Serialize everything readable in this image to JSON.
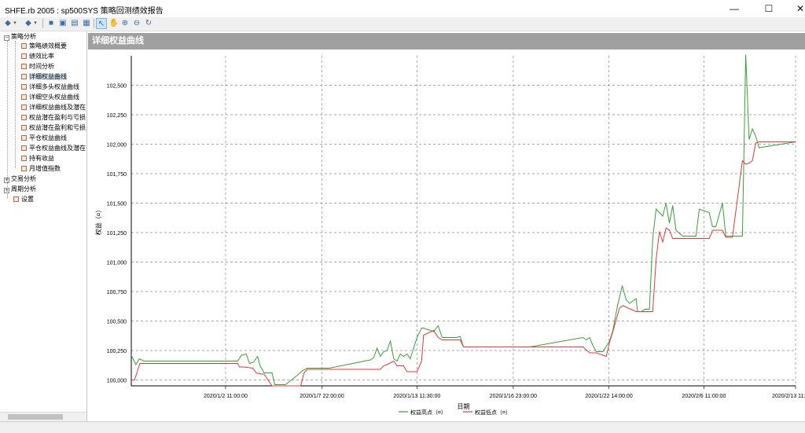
{
  "window": {
    "title": "SHFE.rb 2005 : sp500SYS 策略回测绩效报告",
    "minimize_glyph": "—",
    "maximize_glyph": "☐",
    "close_glyph": "✕"
  },
  "toolbar": {
    "icons": [
      "back-arrow-icon",
      "dropdown-icon",
      "forward-arrow-icon",
      "dropdown-icon",
      "save-icon",
      "print-preview-icon",
      "print-icon",
      "export-icon",
      "pointer-icon",
      "hand-pan-icon",
      "zoom-in-icon",
      "zoom-out-icon",
      "refresh-icon"
    ]
  },
  "tree": {
    "root_label": "策略分析",
    "items": [
      {
        "label": "策略绩效概要"
      },
      {
        "label": "绩效比率"
      },
      {
        "label": "时间分析"
      },
      {
        "label": "详细权益曲线"
      },
      {
        "label": "详细多头权益曲线"
      },
      {
        "label": "详细空头权益曲线"
      },
      {
        "label": "详细权益曲线及潜在"
      },
      {
        "label": "权益潜在盈利与亏损"
      },
      {
        "label": "权益潜在盈利和亏损"
      },
      {
        "label": "平仓权益曲线"
      },
      {
        "label": "平仓权益曲线及潜在"
      },
      {
        "label": "持有收益"
      },
      {
        "label": "月增值指数"
      }
    ],
    "selected_index": 3,
    "trade_label": "交易分析",
    "period_label": "周期分析",
    "settings_label": "设置"
  },
  "panel": {
    "title": "详细权益曲线"
  },
  "chart_data": {
    "type": "line",
    "xlabel": "日期",
    "ylabel": "权益（¤）",
    "ylim": [
      99950,
      102750
    ],
    "yticks": [
      100000,
      100250,
      100500,
      100750,
      101000,
      101250,
      101500,
      101750,
      102000,
      102250,
      102500
    ],
    "ytick_labels": [
      "100,000",
      "100,250",
      "100,500",
      "100,750",
      "101,000",
      "101,250",
      "101,500",
      "101,750",
      "102,000",
      "102,250",
      "102,500"
    ],
    "xlim": [
      0,
      1
    ],
    "xticks": [
      0.142,
      0.287,
      0.43,
      0.575,
      0.719,
      0.862,
      1.0
    ],
    "xtick_labels": [
      "2020/1/2 11:00:00",
      "2020/1/7 22:00:00",
      "2020/1/13 11:30:00",
      "2020/1/16 23:00:00",
      "2020/1/22 14:00:00",
      "2020/2/6 11:00:00",
      "2020/2/13 11:00:00"
    ],
    "grid": true,
    "legend_position": "bottom",
    "series": [
      {
        "name": "权益高点（¤）",
        "color": "#3aa03a",
        "x": [
          0.0,
          0.007,
          0.012,
          0.019,
          0.16,
          0.166,
          0.173,
          0.178,
          0.184,
          0.19,
          0.194,
          0.2,
          0.206,
          0.212,
          0.216,
          0.228,
          0.232,
          0.25,
          0.258,
          0.265,
          0.275,
          0.28,
          0.288,
          0.298,
          0.36,
          0.365,
          0.37,
          0.375,
          0.38,
          0.385,
          0.39,
          0.395,
          0.4,
          0.405,
          0.41,
          0.415,
          0.42,
          0.43,
          0.437,
          0.44,
          0.445,
          0.455,
          0.462,
          0.468,
          0.48,
          0.485,
          0.49,
          0.495,
          0.5,
          0.505,
          0.51,
          0.52,
          0.53,
          0.535,
          0.541,
          0.6,
          0.68,
          0.685,
          0.69,
          0.695,
          0.7,
          0.71,
          0.72,
          0.725,
          0.732,
          0.739,
          0.745,
          0.75,
          0.76,
          0.762,
          0.768,
          0.773,
          0.78,
          0.785,
          0.79,
          0.795,
          0.8,
          0.805,
          0.81,
          0.815,
          0.82,
          0.83,
          0.84,
          0.845,
          0.85,
          0.855,
          0.87,
          0.875,
          0.88,
          0.89,
          0.895,
          0.9,
          0.905,
          0.913,
          0.92,
          0.925,
          0.93,
          0.935,
          0.94,
          0.945,
          1.0
        ],
        "y": [
          100210,
          100130,
          100180,
          100160,
          100160,
          100210,
          100220,
          100140,
          100150,
          100200,
          100120,
          100060,
          100060,
          100060,
          99960,
          99960,
          99960,
          100040,
          100080,
          100100,
          100100,
          100100,
          100100,
          100100,
          100170,
          100190,
          100270,
          100200,
          100240,
          100250,
          100330,
          100180,
          100160,
          100220,
          100200,
          100220,
          100180,
          100360,
          100440,
          100440,
          100430,
          100410,
          100460,
          100360,
          100360,
          100360,
          100360,
          100370,
          100280,
          100280,
          100280,
          100280,
          100280,
          100280,
          100280,
          100280,
          100360,
          100340,
          100360,
          100290,
          100240,
          100240,
          100330,
          100420,
          100630,
          100800,
          100680,
          100650,
          100690,
          100580,
          100580,
          100600,
          100600,
          101200,
          101450,
          101420,
          101390,
          101500,
          101330,
          101480,
          101270,
          101220,
          101220,
          101220,
          101220,
          101450,
          101420,
          101300,
          101300,
          101500,
          101220,
          101220,
          101220,
          101220,
          101220,
          102760,
          102040,
          102130,
          102070,
          101970,
          102020
        ],
        "note": ""
      },
      {
        "name": "权益低点（¤）",
        "color": "#e63a3a",
        "x": [
          0.0,
          0.005,
          0.013,
          0.16,
          0.163,
          0.17,
          0.183,
          0.188,
          0.195,
          0.2,
          0.212,
          0.218,
          0.228,
          0.232,
          0.255,
          0.26,
          0.265,
          0.275,
          0.29,
          0.36,
          0.365,
          0.375,
          0.38,
          0.385,
          0.395,
          0.4,
          0.405,
          0.41,
          0.415,
          0.43,
          0.437,
          0.44,
          0.455,
          0.462,
          0.468,
          0.48,
          0.495,
          0.5,
          0.53,
          0.6,
          0.68,
          0.69,
          0.7,
          0.71,
          0.715,
          0.72,
          0.725,
          0.735,
          0.74,
          0.76,
          0.785,
          0.79,
          0.795,
          0.8,
          0.805,
          0.81,
          0.815,
          0.82,
          0.83,
          0.84,
          0.87,
          0.875,
          0.88,
          0.89,
          0.895,
          0.9,
          0.905,
          0.92,
          0.925,
          0.93,
          0.935,
          0.94,
          0.945,
          1.0
        ],
        "y": [
          100000,
          100000,
          100140,
          100140,
          100110,
          100110,
          100100,
          100060,
          100050,
          100050,
          99950,
          99950,
          99950,
          99950,
          99950,
          100060,
          100090,
          100090,
          100090,
          100090,
          100090,
          100090,
          100120,
          100130,
          100160,
          100120,
          100120,
          100120,
          100070,
          100070,
          100160,
          100380,
          100420,
          100360,
          100340,
          100340,
          100340,
          100280,
          100280,
          100280,
          100280,
          100230,
          100230,
          100210,
          100200,
          100320,
          100410,
          100610,
          100630,
          100580,
          100580,
          101020,
          101260,
          101170,
          101290,
          101270,
          101200,
          101200,
          101200,
          101200,
          101200,
          101270,
          101270,
          101270,
          101210,
          101210,
          101210,
          101860,
          101830,
          101840,
          101860,
          102010,
          102020,
          102020
        ],
        "note": ""
      }
    ]
  }
}
